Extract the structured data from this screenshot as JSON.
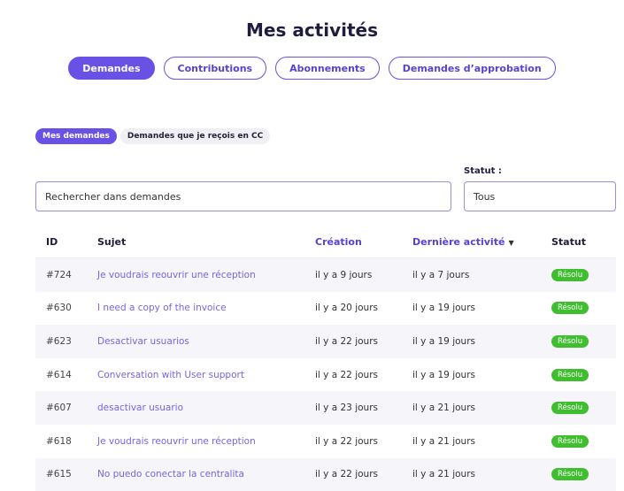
{
  "page_title": "Mes activités",
  "tabs": [
    {
      "label": "Demandes",
      "active": true
    },
    {
      "label": "Contributions",
      "active": false
    },
    {
      "label": "Abonnements",
      "active": false
    },
    {
      "label": "Demandes d’approbation",
      "active": false
    }
  ],
  "subtabs": [
    {
      "label": "Mes demandes",
      "active": true
    },
    {
      "label": "Demandes que je reçois en CC",
      "active": false
    }
  ],
  "search": {
    "placeholder": "Rechercher dans demandes"
  },
  "status_filter": {
    "label": "Statut :",
    "value": "Tous"
  },
  "table": {
    "headers": {
      "id": "ID",
      "subject": "Sujet",
      "created": "Création",
      "last_activity": "Dernière activité",
      "status": "Statut"
    },
    "rows": [
      {
        "id": "#724",
        "subject": "Je voudrais reouvrir une réception",
        "created": "il y a 9 jours",
        "last": "il y a 7 jours",
        "status": "Résolu"
      },
      {
        "id": "#630",
        "subject": "I need a copy of the invoice",
        "created": "il y a 20 jours",
        "last": "il y a 19 jours",
        "status": "Résolu"
      },
      {
        "id": "#623",
        "subject": "Desactivar usuarios",
        "created": "il y a 22 jours",
        "last": "il y a 19 jours",
        "status": "Résolu"
      },
      {
        "id": "#614",
        "subject": "Conversation with User support",
        "created": "il y a 22 jours",
        "last": "il y a 19 jours",
        "status": "Résolu"
      },
      {
        "id": "#607",
        "subject": "desactivar usuario",
        "created": "il y a 23 jours",
        "last": "il y a 21 jours",
        "status": "Résolu"
      },
      {
        "id": "#618",
        "subject": "Je voudrais reouvrir une réception",
        "created": "il y a 22 jours",
        "last": "il y a 21 jours",
        "status": "Résolu"
      },
      {
        "id": "#615",
        "subject": "No puedo conectar la centralita",
        "created": "il y a 22 jours",
        "last": "il y a 21 jours",
        "status": "Résolu"
      }
    ]
  },
  "colors": {
    "accent": "#6a51e5",
    "link": "#7a63e6",
    "success": "#3fbf2f"
  }
}
